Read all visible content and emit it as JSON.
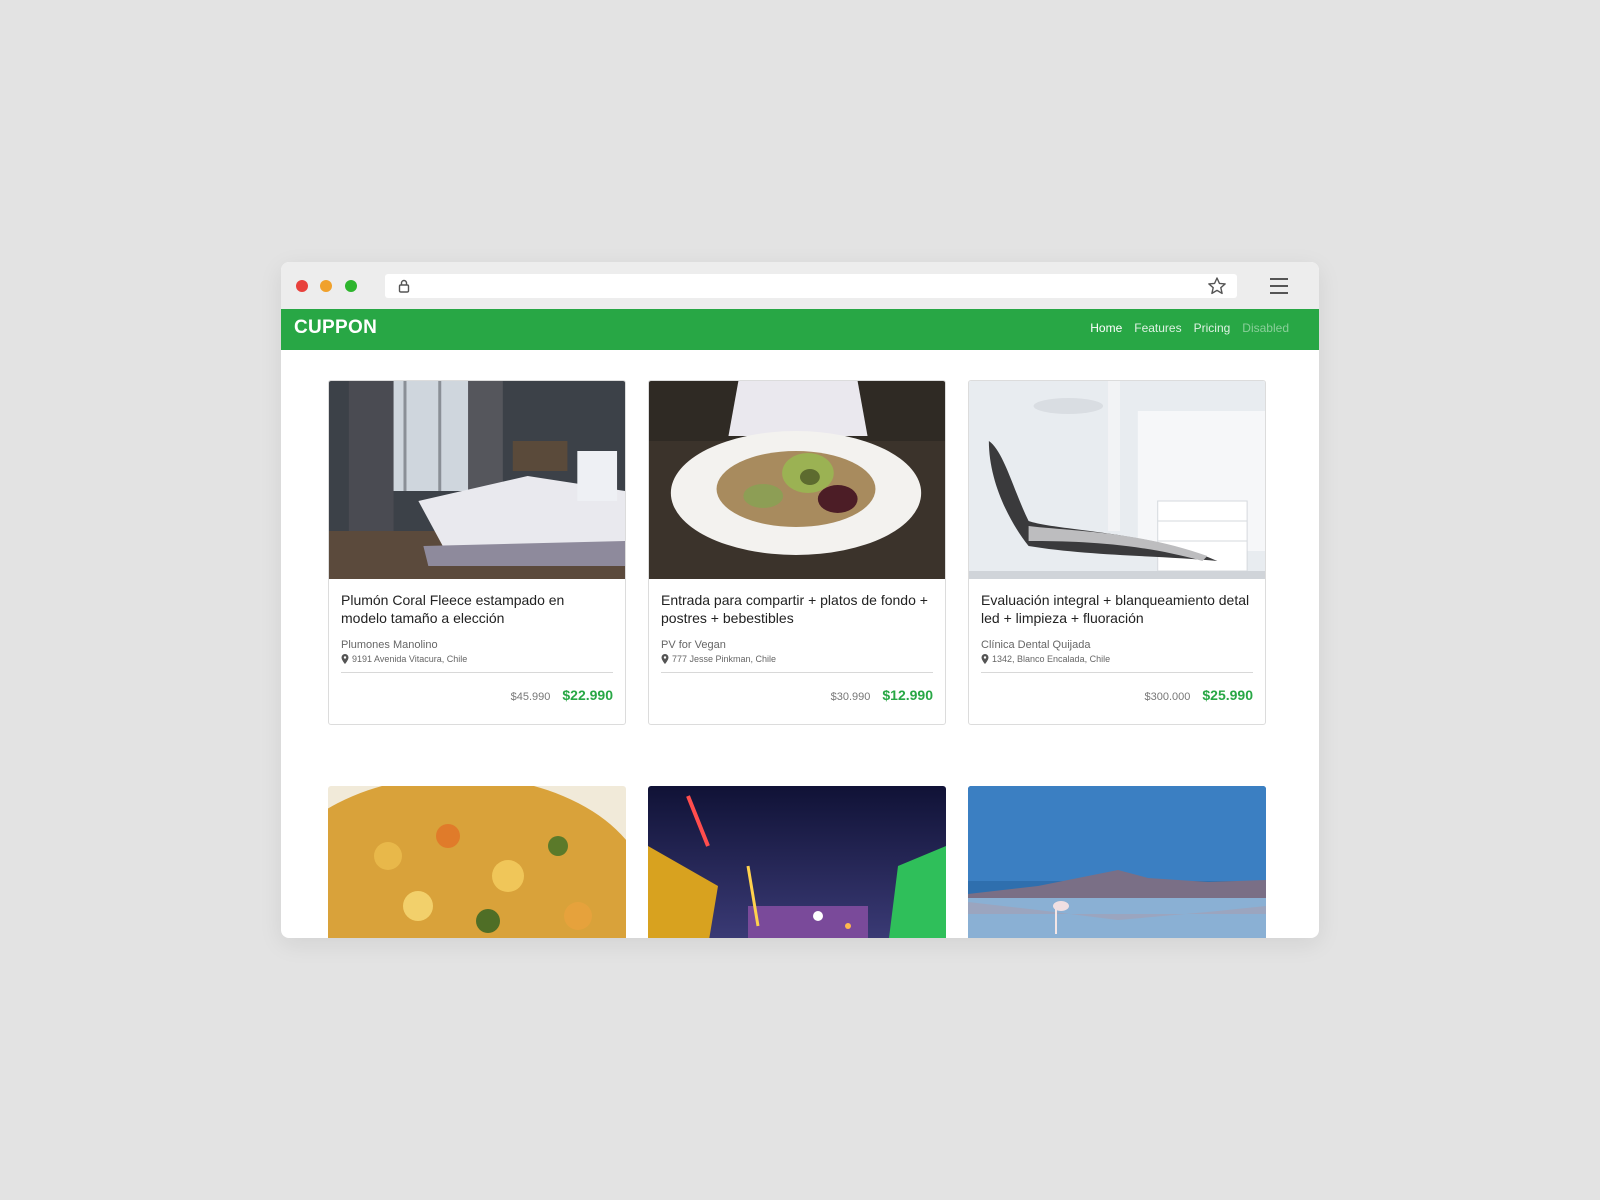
{
  "navbar": {
    "brand": "CUPPON",
    "links": [
      {
        "label": "Home",
        "state": "active"
      },
      {
        "label": "Features",
        "state": "normal"
      },
      {
        "label": "Pricing",
        "state": "normal"
      },
      {
        "label": "Disabled",
        "state": "disabled"
      }
    ]
  },
  "colors": {
    "accent": "#28a745",
    "background": "#e3e3e3"
  },
  "icons": [
    "lock-icon",
    "star-icon",
    "hamburger-menu-icon",
    "map-pin-icon"
  ],
  "cards": [
    {
      "title": "Plumón Coral Fleece estampado en modelo tamaño a elección",
      "merchant": "Plumones Manolino",
      "address": "9191 Avenida Vitacura, Chile",
      "old_price": "$45.990",
      "new_price": "$22.990"
    },
    {
      "title": "Entrada para compartir + platos de fondo + postres + bebestibles",
      "merchant": "PV for Vegan",
      "address": "777 Jesse Pinkman, Chile",
      "old_price": "$30.990",
      "new_price": "$12.990"
    },
    {
      "title": "Evaluación integral + blanqueamiento detal led + limpieza + fluoración",
      "merchant": "Clínica Dental Quijada",
      "address": "1342, Blanco Encalada, Chile",
      "old_price": "$300.000",
      "new_price": "$25.990"
    }
  ]
}
